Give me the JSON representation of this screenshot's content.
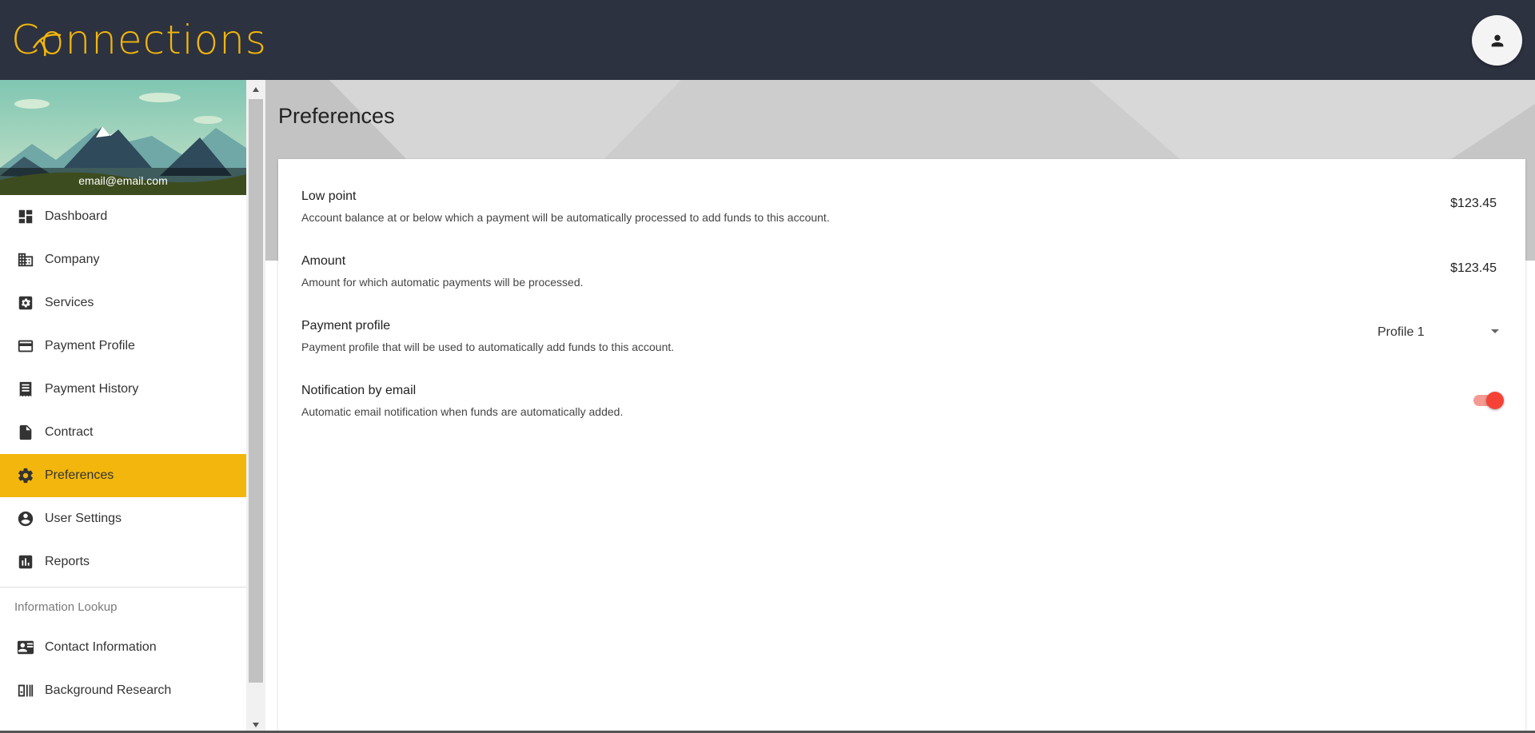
{
  "header": {
    "logo_text": "Connections",
    "brand_color": "#f2b60c",
    "avatar_icon": "person-icon"
  },
  "sidebar": {
    "email": "email@email.com",
    "items": [
      {
        "label": "Dashboard",
        "icon": "dashboard-icon",
        "active": false
      },
      {
        "label": "Company",
        "icon": "building-icon",
        "active": false
      },
      {
        "label": "Services",
        "icon": "gear-box-icon",
        "active": false
      },
      {
        "label": "Payment Profile",
        "icon": "credit-card-icon",
        "active": false
      },
      {
        "label": "Payment History",
        "icon": "receipt-icon",
        "active": false
      },
      {
        "label": "Contract",
        "icon": "document-icon",
        "active": false
      },
      {
        "label": "Preferences",
        "icon": "gear-icon",
        "active": true
      },
      {
        "label": "User Settings",
        "icon": "account-circle-icon",
        "active": false
      },
      {
        "label": "Reports",
        "icon": "bar-chart-icon",
        "active": false
      }
    ],
    "section_header": "Information Lookup",
    "lookup_items": [
      {
        "label": "Contact Information",
        "icon": "contact-card-icon"
      },
      {
        "label": "Background Research",
        "icon": "barcode-icon"
      }
    ]
  },
  "main": {
    "page_title": "Preferences",
    "preferences": [
      {
        "title": "Low point",
        "description": "Account balance at or below which a payment will be automatically processed to add funds to this account.",
        "value": "$123.45"
      },
      {
        "title": "Amount",
        "description": "Amount for which automatic payments will be processed.",
        "value": "$123.45"
      },
      {
        "title": "Payment profile",
        "description": "Payment profile that will be used to automatically add funds to this account.",
        "value": "Profile 1"
      },
      {
        "title": "Notification by email",
        "description": "Automatic email notification when funds are automatically added.",
        "enabled": true
      }
    ]
  },
  "colors": {
    "header_bg": "#2d3240",
    "active_item": "#f2b60c",
    "toggle_on": "#f44336"
  }
}
